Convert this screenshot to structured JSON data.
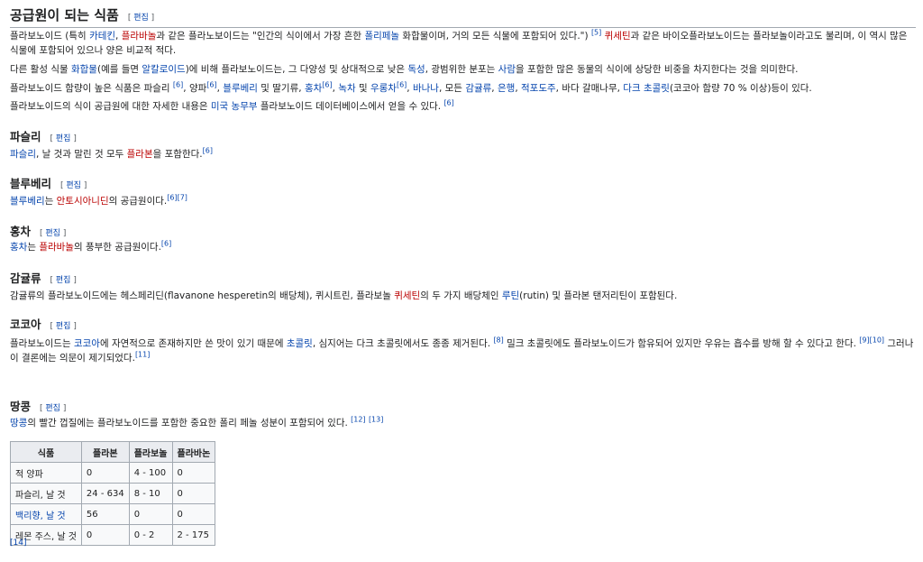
{
  "edit_label": "편집",
  "title": "공급원이 되는 식품",
  "intro": [
    [
      {
        "t": "플라보노이드 (특히 "
      },
      {
        "t": "카테킨",
        "k": "link"
      },
      {
        "t": ", "
      },
      {
        "t": "플라바놀",
        "k": "red"
      },
      {
        "t": "과 같은 플라노보이드는 \"인간의 식이에서 가장 흔한 "
      },
      {
        "t": "폴리페놀",
        "k": "link"
      },
      {
        "t": " 화합물이며, 거의 모든 식물에 포함되어 있다.\") "
      },
      {
        "t": "[5]",
        "k": "ref"
      },
      {
        "t": " "
      },
      {
        "t": "퀴세틴",
        "k": "red"
      },
      {
        "t": "과 같은 바이오플라보노이드는 플라보놀이라고도 불리며, 이 역시 많은 식물에 포함되어 있으나 양은 비교적 적다."
      }
    ],
    [
      {
        "t": "다른 활성 식물 "
      },
      {
        "t": "화합물",
        "k": "link"
      },
      {
        "t": "(예를 들면 "
      },
      {
        "t": "알칼로이드",
        "k": "link"
      },
      {
        "t": ")에 비해 플라보노이드는, 그 다양성 및 상대적으로 낮은 "
      },
      {
        "t": "독성",
        "k": "link"
      },
      {
        "t": ", 광범위한 분포는 "
      },
      {
        "t": "사람",
        "k": "link"
      },
      {
        "t": "을 포함한 많은 동물의 식이에 상당한 비중을 차지한다는 것을 의미한다."
      }
    ],
    [
      {
        "t": "플라보노이드 함량이 높은 식품은 파슬리 "
      },
      {
        "t": "[6]",
        "k": "ref"
      },
      {
        "t": ", 양파"
      },
      {
        "t": "[6]",
        "k": "ref"
      },
      {
        "t": ", "
      },
      {
        "t": "블루베리",
        "k": "link"
      },
      {
        "t": " 및 딸기류, "
      },
      {
        "t": "홍차",
        "k": "link"
      },
      {
        "t": "[6]",
        "k": "ref"
      },
      {
        "t": ", "
      },
      {
        "t": "녹차",
        "k": "link"
      },
      {
        "t": " 및 "
      },
      {
        "t": "우롱차",
        "k": "link"
      },
      {
        "t": "[6]",
        "k": "ref"
      },
      {
        "t": ", "
      },
      {
        "t": "바나나",
        "k": "link"
      },
      {
        "t": ", 모든 "
      },
      {
        "t": "감귤류",
        "k": "link"
      },
      {
        "t": ", "
      },
      {
        "t": "은행",
        "k": "link"
      },
      {
        "t": ", "
      },
      {
        "t": "적포도주",
        "k": "link"
      },
      {
        "t": ", 바다 갈매나무, "
      },
      {
        "t": "다크 초콜릿",
        "k": "link"
      },
      {
        "t": "(코코아 함량 70 % 이상)등이 있다."
      }
    ],
    [
      {
        "t": "플라보노이드의 식이 공급원에 대한 자세한 내용은 "
      },
      {
        "t": "미국 농무부",
        "k": "link"
      },
      {
        "t": " 플라보노이드 데이터베이스에서 얻을 수 있다. "
      },
      {
        "t": "[6]",
        "k": "ref"
      }
    ]
  ],
  "sections": [
    {
      "title": "파슬리",
      "para": [
        {
          "t": "파슬리",
          "k": "link"
        },
        {
          "t": ", 날 것과 말린 것 모두 "
        },
        {
          "t": "플라본",
          "k": "red"
        },
        {
          "t": "을 포함한다."
        },
        {
          "t": "[6]",
          "k": "ref"
        }
      ]
    },
    {
      "title": "블루베리",
      "para": [
        {
          "t": "블루베리",
          "k": "link"
        },
        {
          "t": "는 "
        },
        {
          "t": "안토시아니딘",
          "k": "red"
        },
        {
          "t": "의 공급원이다."
        },
        {
          "t": "[6][7]",
          "k": "ref"
        }
      ]
    },
    {
      "title": "홍차",
      "para": [
        {
          "t": "홍차",
          "k": "link"
        },
        {
          "t": "는 "
        },
        {
          "t": "플라바놀",
          "k": "red"
        },
        {
          "t": "의 풍부한 공급원이다."
        },
        {
          "t": "[6]",
          "k": "ref"
        }
      ]
    },
    {
      "title": "감귤류",
      "para": [
        {
          "t": "감귤류의 플라보노이드에는 헤스페리딘(flavanone hesperetin의 배당체), 퀴시트린, 플라보놀 "
        },
        {
          "t": "퀴세틴",
          "k": "red"
        },
        {
          "t": "의 두 가지 배당체인 "
        },
        {
          "t": "루틴",
          "k": "link"
        },
        {
          "t": "(rutin) 및 플라본 탠저리틴이 포함된다."
        }
      ]
    },
    {
      "title": "코코아",
      "para": [
        {
          "t": "플라보노이드는 "
        },
        {
          "t": "코코아",
          "k": "link"
        },
        {
          "t": "에 자연적으로 존재하지만 쓴 맛이 있기 때문에 "
        },
        {
          "t": "초콜릿",
          "k": "link"
        },
        {
          "t": ", 심지어는 다크 초콜릿에서도 종종 제거된다. "
        },
        {
          "t": "[8]",
          "k": "ref"
        },
        {
          "t": " 밀크 초콜릿에도 플라보노이드가 함유되어 있지만 우유는 흡수를 방해 할 수 있다고 한다. "
        },
        {
          "t": "[9][10]",
          "k": "ref"
        },
        {
          "t": " 그러나 이 결론에는 의문이 제기되었다."
        },
        {
          "t": "[11]",
          "k": "ref"
        }
      ]
    },
    {
      "title": "땅콩",
      "para": [
        {
          "t": "땅콩",
          "k": "link"
        },
        {
          "t": "의 빨간 껍질에는 플라보노이드를 포함한 중요한 폴리 페놀 성분이 포함되어 있다. "
        },
        {
          "t": "[12]",
          "k": "ref"
        },
        {
          "t": " "
        },
        {
          "t": "[13]",
          "k": "ref"
        }
      ]
    }
  ],
  "table": {
    "headers": [
      "식품",
      "플라본",
      "플라보놀",
      "플라바논"
    ],
    "rows": [
      [
        "적 양파",
        "0",
        "4 - 100",
        "0"
      ],
      [
        "파슬리, 날 것",
        "24 - 634",
        "8 - 10",
        "0"
      ],
      [
        "백리향, 날 것",
        "56",
        "0",
        "0"
      ],
      [
        "레몬 주스, 날 것",
        "0",
        "0 - 2",
        "2 - 175"
      ]
    ]
  },
  "table_ref": "[14]"
}
